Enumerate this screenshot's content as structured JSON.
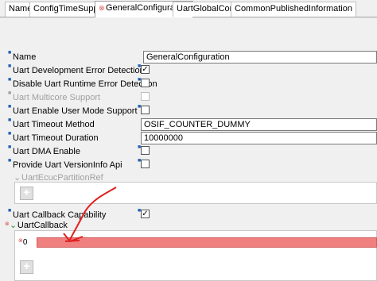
{
  "tabs": [
    {
      "label": "Name",
      "active": false,
      "error": false
    },
    {
      "label": "ConfigTimeSupport",
      "active": false,
      "error": false
    },
    {
      "label": "GeneralConfiguration",
      "active": true,
      "error": true
    },
    {
      "label": "UartGlobalConfig",
      "active": false,
      "error": false
    },
    {
      "label": "CommonPublishedInformation",
      "active": false,
      "error": false
    }
  ],
  "fields": {
    "name": {
      "label": "Name",
      "value": "GeneralConfiguration"
    },
    "dev_error_detect": {
      "label": "Uart Development Error Detection",
      "checked": true
    },
    "disable_runtime_error": {
      "label": "Disable Uart Runtime Error Detection",
      "checked": false
    },
    "multicore_support": {
      "label": "Uart Multicore Support",
      "checked": false,
      "disabled": true
    },
    "user_mode_support": {
      "label": "Uart Enable User Mode Support",
      "checked": false
    },
    "timeout_method": {
      "label": "Uart Timeout Method",
      "value": "OSIF_COUNTER_DUMMY"
    },
    "timeout_duration": {
      "label": "Uart Timeout Duration",
      "value": "10000000"
    },
    "dma_enable": {
      "label": "Uart DMA Enable",
      "checked": false
    },
    "version_info_api": {
      "label": "Provide Uart VersionInfo Api",
      "checked": false
    },
    "callback_capability": {
      "label": "Uart Callback Capability",
      "checked": true
    }
  },
  "ecuc_partition": {
    "label": "UartEcucPartitionRef"
  },
  "callback": {
    "label": "UartCallback",
    "index_label": "0"
  },
  "check_glyph": "✓",
  "add_glyph": "+",
  "colors": {
    "error_bar": "#f08080",
    "annotation": "#e02020",
    "expand_green": "#2e8b2e"
  }
}
